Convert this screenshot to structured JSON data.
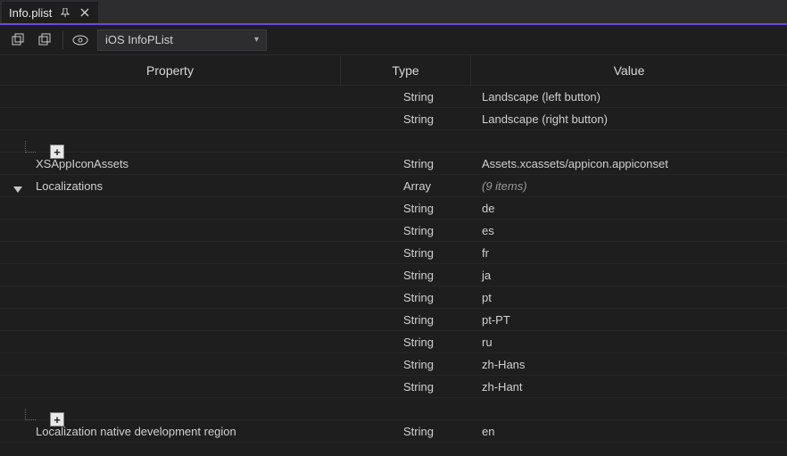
{
  "tab": {
    "title": "Info.plist"
  },
  "toolbar": {
    "dropdown_label": "iOS InfoPList"
  },
  "columns": {
    "property": "Property",
    "type": "Type",
    "value": "Value"
  },
  "rows": [
    {
      "prop": "",
      "type": "String",
      "value": "Landscape (left button)",
      "tl": true
    },
    {
      "prop": "",
      "type": "String",
      "value": "Landscape (right button)",
      "tl": true
    },
    {
      "prop": "",
      "type": "",
      "value": "",
      "add": true,
      "elbow": true
    },
    {
      "prop": "XSAppIconAssets",
      "type": "String",
      "value": "Assets.xcassets/appicon.appiconset"
    },
    {
      "prop": "Localizations",
      "type": "Array",
      "value": "(9 items)",
      "italic": true,
      "expander": true
    },
    {
      "prop": "",
      "type": "String",
      "value": "de",
      "tl": true
    },
    {
      "prop": "",
      "type": "String",
      "value": "es",
      "tl": true
    },
    {
      "prop": "",
      "type": "String",
      "value": "fr",
      "tl": true
    },
    {
      "prop": "",
      "type": "String",
      "value": "ja",
      "tl": true
    },
    {
      "prop": "",
      "type": "String",
      "value": "pt",
      "tl": true
    },
    {
      "prop": "",
      "type": "String",
      "value": "pt-PT",
      "tl": true
    },
    {
      "prop": "",
      "type": "String",
      "value": "ru",
      "tl": true
    },
    {
      "prop": "",
      "type": "String",
      "value": "zh-Hans",
      "tl": true
    },
    {
      "prop": "",
      "type": "String",
      "value": "zh-Hant",
      "tl": true
    },
    {
      "prop": "",
      "type": "",
      "value": "",
      "add": true,
      "elbow": true
    },
    {
      "prop": "Localization native development region",
      "type": "String",
      "value": "en"
    }
  ]
}
